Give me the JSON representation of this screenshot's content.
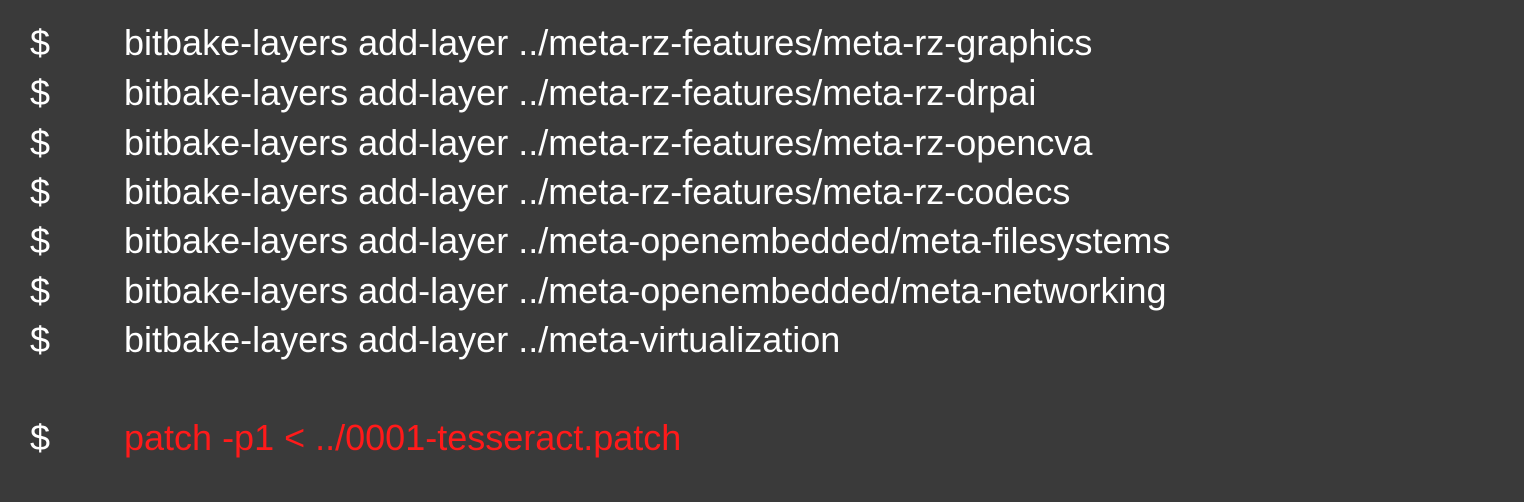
{
  "terminal": {
    "prompt": "$",
    "lines": [
      {
        "cmd": "bitbake-layers add-layer ../meta-rz-features/meta-rz-graphics"
      },
      {
        "cmd": "bitbake-layers add-layer ../meta-rz-features/meta-rz-drpai"
      },
      {
        "cmd": "bitbake-layers add-layer ../meta-rz-features/meta-rz-opencva"
      },
      {
        "cmd": "bitbake-layers add-layer ../meta-rz-features/meta-rz-codecs"
      },
      {
        "cmd": "bitbake-layers add-layer ../meta-openembedded/meta-filesystems"
      },
      {
        "cmd": "bitbake-layers add-layer ../meta-openembedded/meta-networking"
      },
      {
        "cmd": "bitbake-layers add-layer ../meta-virtualization"
      }
    ],
    "highlight_line": {
      "cmd": "patch -p1 < ../0001-tesseract.patch"
    }
  },
  "colors": {
    "background": "#3a3a3a",
    "text": "#ffffff",
    "highlight": "#ff1a1a"
  }
}
